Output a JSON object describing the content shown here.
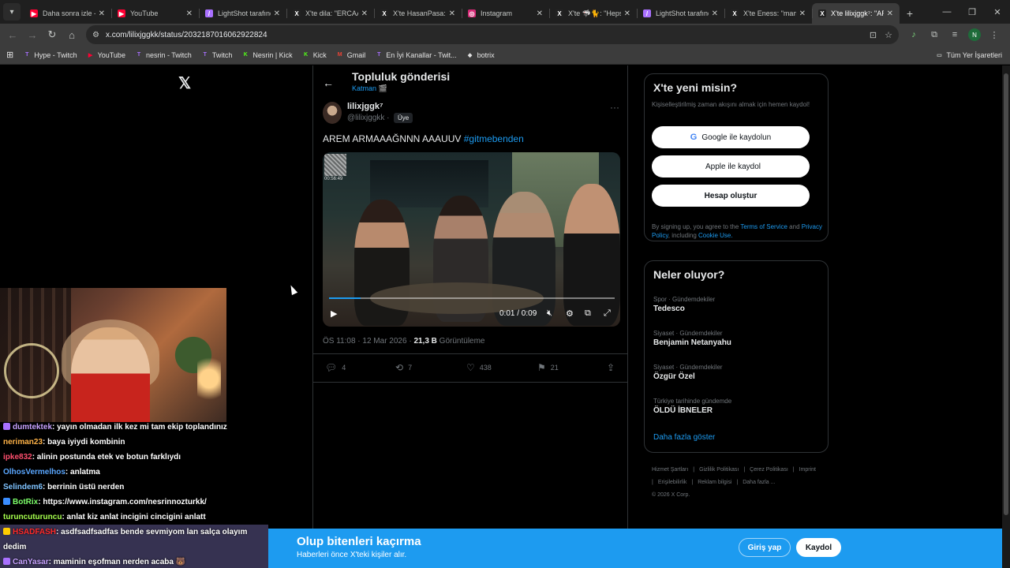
{
  "browser": {
    "tabs": [
      {
        "label": "Daha sonra izle - Y",
        "fav_color": "#ff0033",
        "fav_glyph": "▶"
      },
      {
        "label": "YouTube",
        "fav_color": "#ff0033",
        "fav_glyph": "▶"
      },
      {
        "label": "LightShot tarafından",
        "fav_color": "#a970ff",
        "fav_glyph": "/"
      },
      {
        "label": "X'te dila: \"ERCAAN",
        "fav_color": "#222",
        "fav_glyph": "X"
      },
      {
        "label": "X'te HasanPasa: \"y",
        "fav_color": "#222",
        "fav_glyph": "X"
      },
      {
        "label": "Instagram",
        "fav_color": "#d62976",
        "fav_glyph": "◎"
      },
      {
        "label": "X'te 🦈🐈: \"Hepsi",
        "fav_color": "#222",
        "fav_glyph": "X"
      },
      {
        "label": "LightShot tarafından",
        "fav_color": "#a970ff",
        "fav_glyph": "/"
      },
      {
        "label": "X'te Eness: \"mam",
        "fav_color": "#222",
        "fav_glyph": "X"
      },
      {
        "label": "X'te lilixjggk⁷: \"AR",
        "fav_color": "#222",
        "fav_glyph": "X",
        "active": true
      }
    ],
    "url": "x.com/lilixjggkk/status/2032187016062922824",
    "profile_initial": "N",
    "bookmarks": [
      {
        "label": "Hype - Twitch",
        "color": "#a970ff",
        "glyph": "T"
      },
      {
        "label": "YouTube",
        "color": "#ff0033",
        "glyph": "▶"
      },
      {
        "label": "nesrin - Twitch",
        "color": "#a970ff",
        "glyph": "T"
      },
      {
        "label": "Twitch",
        "color": "#a970ff",
        "glyph": "T"
      },
      {
        "label": "Nesrin | Kick",
        "color": "#53fc18",
        "glyph": "K"
      },
      {
        "label": "Kick",
        "color": "#53fc18",
        "glyph": "K"
      },
      {
        "label": "Gmail",
        "color": "#ea4335",
        "glyph": "M"
      },
      {
        "label": "En İyi Kanallar - Twit...",
        "color": "#a970ff",
        "glyph": "T"
      },
      {
        "label": "botrix",
        "color": "#e0e0e0",
        "glyph": "◆"
      }
    ],
    "all_bookmarks": "Tüm Yer İşaretleri"
  },
  "post": {
    "header_title": "Topluluk gönderisi",
    "header_sub": "Katman 🎬",
    "author_name": "lilixjggk⁷",
    "author_handle": "@lilixjggkk ·",
    "member_badge": "Üye",
    "text": "AREM ARMAAAĞNNN AAAUUV ",
    "hashtag": "#gitmebenden",
    "video": {
      "time": "0:01 / 0:09",
      "overlay_time": "00:56:49",
      "progress": 0.11
    },
    "meta_time": "ÖS 11:08 · 12 Mar 2026 · ",
    "views_count": "21,3 B",
    "views_label": " Görüntüleme",
    "replies": "4",
    "reposts": "7",
    "likes": "438",
    "bookmarks": "21"
  },
  "signup": {
    "title": "X'te yeni misin?",
    "subtitle": "Kişiselleştirilmiş zaman akışını almak için hemen kaydol!",
    "google": "Google ile kaydolun",
    "apple": "Apple ile kaydol",
    "create": "Hesap oluştur",
    "terms_pre": "By signing up, you agree to the ",
    "terms_tos": "Terms of Service",
    "terms_and": " and ",
    "terms_privacy": "Privacy Policy",
    "terms_incl": ", including ",
    "terms_cookie": "Cookie Use."
  },
  "trends": {
    "title": "Neler oluyor?",
    "items": [
      {
        "context": "Spor · Gündemdekiler",
        "topic": "Tedesco"
      },
      {
        "context": "Siyaset · Gündemdekiler",
        "topic": "Benjamin Netanyahu"
      },
      {
        "context": "Siyaset · Gündemdekiler",
        "topic": "Özgür Özel"
      },
      {
        "context": "Türkiye tarihinde gündemde",
        "topic": "ÖLDÜ İBNELER"
      }
    ],
    "show_more": "Daha fazla göster"
  },
  "footer": {
    "links": [
      "Hizmet Şartları",
      "|",
      "Gizlilik Politikası",
      "|",
      "Çerez Politikası",
      "|",
      "Imprint",
      "|",
      "Erişilebilirlik",
      "|",
      "Reklam bilgisi",
      "|",
      "Daha fazla ...",
      "© 2026 X Corp."
    ]
  },
  "chat": [
    {
      "user": "dumtektek",
      "color": "#c7a2ff",
      "msg": ": yayın olmadan ilk kez mi tam ekip toplandınız",
      "badge": "#a970ff"
    },
    {
      "user": "neriman23",
      "color": "#ffb347",
      "msg": ": baya iyiydi kombinin"
    },
    {
      "user": "ipke832",
      "color": "#ff4f6e",
      "msg": ": alinin postunda etek ve botun farklıydı"
    },
    {
      "user": "OlhosVermelhos",
      "color": "#5aa7ff",
      "msg": ": anlatma"
    },
    {
      "user": "Selindem6",
      "color": "#7fc3ff",
      "msg": ": berrinin üstü nerden"
    },
    {
      "user": "BotRix",
      "color": "#7dff6a",
      "msg": ": https://www.instagram.com/nesrinnozturkk/",
      "badge": "#3a8dff"
    },
    {
      "user": "turuncuturuncu",
      "color": "#a6ff4d",
      "msg": ": anlat kiz anlat incigini cincigini anlatt"
    },
    {
      "user": "HSADFASH",
      "color": "#ff2a2a",
      "msg": ": asdfsadfsadfas bende sevmiyom lan salça olayım",
      "badge": "#ffcc00"
    },
    {
      "user": "",
      "color": "#fff",
      "msg": "dedim"
    },
    {
      "user": "CanYasar",
      "color": "#c7a2ff",
      "msg": ": maminin eşofman nerden acaba 🐻",
      "badge": "#a970ff"
    }
  ],
  "banner": {
    "title": "Olup bitenleri kaçırma",
    "subtitle": "Haberleri önce X'teki kişiler alır.",
    "login": "Giriş yap",
    "join": "Kaydol"
  },
  "colors": {
    "accent": "#1d9bf0",
    "background": "#000000",
    "border": "#2f3336"
  }
}
